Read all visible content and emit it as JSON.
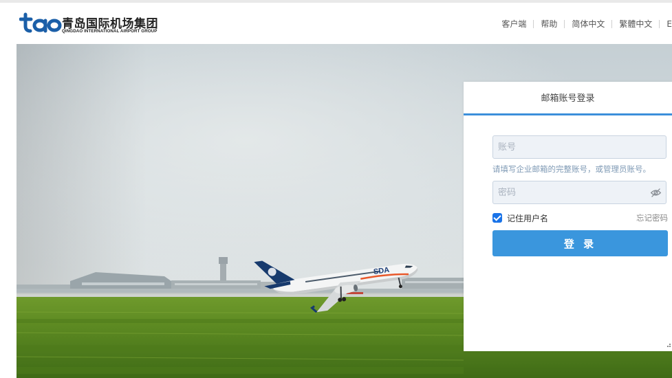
{
  "brand": {
    "mark_text": "tao",
    "name_cn": "青岛国际机场集团",
    "name_en": "QINGDAO INTERNATIONAL AIRPORT GROUP"
  },
  "topnav": {
    "items": [
      "客户端",
      "帮助",
      "简体中文",
      "繁體中文",
      "E"
    ]
  },
  "hero": {
    "aircraft_livery": "SDA"
  },
  "login": {
    "tab_label": "邮箱账号登录",
    "account_placeholder": "账号",
    "account_hint": "请填写企业邮箱的完整账号，或管理员账号。",
    "password_placeholder": "密码",
    "remember_label": "记住用户名",
    "remember_checked": true,
    "forgot_label": "忘记密码",
    "submit_label": "登 录"
  },
  "colors": {
    "accent": "#3a96dd",
    "tab_underline": "#3b8fdb",
    "input_bg": "#eef2f7",
    "hint": "#7f9ab5"
  },
  "icons": {
    "password_toggle": "eye-slash-icon",
    "checkbox": "check-icon"
  }
}
